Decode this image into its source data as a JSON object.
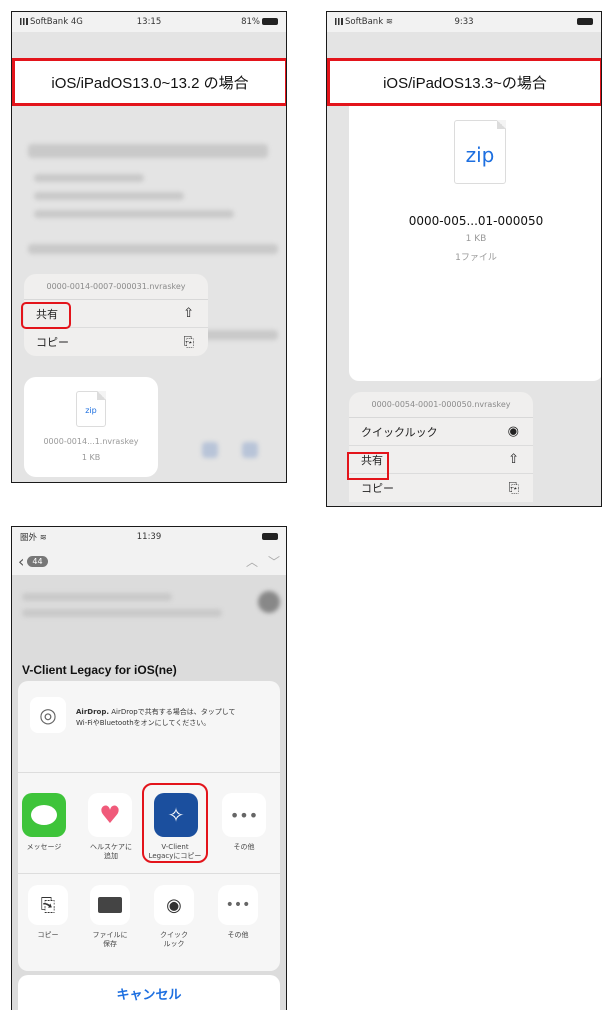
{
  "screens": {
    "ios130": {
      "status": {
        "carrier": "SoftBank 4G",
        "time": "13:15",
        "battery": "81%"
      },
      "banner": "iOS/iPadOS13.0~13.2 の場合",
      "menu": {
        "filename": "0000-0014-0007-000031.nvraskey",
        "share_label": "共有",
        "copy_label": "コピー"
      },
      "preview": {
        "badge": "zip",
        "name": "0000-0014...1.nvraskey",
        "size": "1 KB"
      }
    },
    "ios133": {
      "status": {
        "carrier": "SoftBank",
        "time": "9:33"
      },
      "banner": "iOS/iPadOS13.3~の場合",
      "file": {
        "badge": "zip",
        "name": "0000-005...01-000050",
        "size": "1 KB",
        "count": "1ファイル"
      },
      "menu": {
        "filename": "0000-0054-0001-000050.nvraskey",
        "quicklook_label": "クイックルック",
        "share_label": "共有",
        "copy_label": "コピー"
      }
    },
    "share": {
      "status": {
        "carrier": "圏外",
        "time": "11:39"
      },
      "back_count": "44",
      "subject": "V-Client Legacy for iOS(ne)",
      "airdrop": {
        "title": "AirDrop.",
        "text": "AirDropで共有する場合は、タップして",
        "text2": "Wi-FiやBluetoothをオンにしてください。"
      },
      "apps": [
        {
          "label": "メッセージ"
        },
        {
          "label": "ヘルスケアに\n追加"
        },
        {
          "label": "V-Client\nLegacyにコピー"
        },
        {
          "label": "その他"
        }
      ],
      "actions": [
        {
          "label": "コピー"
        },
        {
          "label": "ファイルに\n保存"
        },
        {
          "label": "クイック\nルック"
        },
        {
          "label": "その他"
        }
      ],
      "cancel_label": "キャンセル"
    }
  },
  "colors": {
    "highlight": "#e3141b",
    "link_blue": "#1d6fe0",
    "messages_green": "#3ec43a"
  }
}
